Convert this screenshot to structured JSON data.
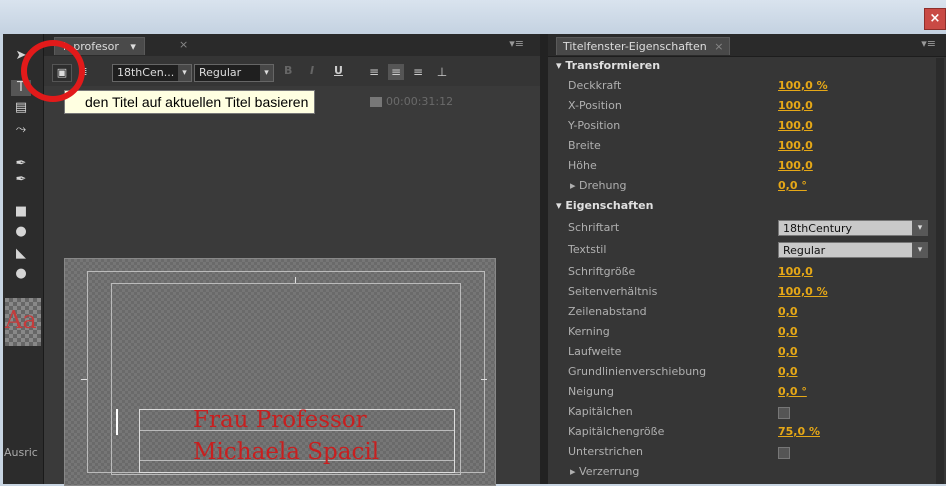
{
  "window": {
    "close_glyph": "×"
  },
  "tools": {
    "icons": [
      "selection-arrow-icon",
      "type-tool-icon",
      "area-type-icon",
      "path-type-icon",
      "pen-tool-icon",
      "add-anchor-icon",
      "rectangle-tool-icon",
      "ellipse-tool-icon",
      "wedge-tool-icon",
      "ellipse-small-icon"
    ],
    "swatch_text": "Aa",
    "bottom_label": "Ausric"
  },
  "title_panel": {
    "tab_label": "l: profesor",
    "tab_dropdown": "▾",
    "tab_close": "×",
    "menu_glyph": "▾≡",
    "toolbar": {
      "font_name": "18thCen...",
      "font_style": "Regular",
      "bold": "B",
      "italic": "I",
      "underline": "U"
    },
    "tooltip": "den Titel auf aktuellen Titel basieren",
    "timecode": "00:00:31:12",
    "text_lines": [
      "Frau Professor",
      "Michaela Spacil"
    ]
  },
  "properties": {
    "tab_label": "Titelfenster-Eigenschaften",
    "tab_close": "×",
    "menu_glyph": "▾≡",
    "sections": {
      "transform": "Transformieren",
      "properties": "Eigenschaften"
    },
    "rows": {
      "deckkraft": {
        "label": "Deckkraft",
        "value": "100,0 %"
      },
      "xpos": {
        "label": "X-Position",
        "value": "100,0"
      },
      "ypos": {
        "label": "Y-Position",
        "value": "100,0"
      },
      "breite": {
        "label": "Breite",
        "value": "100,0"
      },
      "hoehe": {
        "label": "Höhe",
        "value": "100,0"
      },
      "drehung": {
        "label": "Drehung",
        "value": "0,0 °"
      },
      "schriftart": {
        "label": "Schriftart",
        "value": "18thCentury"
      },
      "textstil": {
        "label": "Textstil",
        "value": "Regular"
      },
      "schriftgroesse": {
        "label": "Schriftgröße",
        "value": "100,0"
      },
      "seitenverhaeltnis": {
        "label": "Seitenverhältnis",
        "value": "100,0 %"
      },
      "zeilenabstand": {
        "label": "Zeilenabstand",
        "value": "0,0"
      },
      "kerning": {
        "label": "Kerning",
        "value": "0,0"
      },
      "laufweite": {
        "label": "Laufweite",
        "value": "0,0"
      },
      "grundlinie": {
        "label": "Grundlinienverschiebung",
        "value": "0,0"
      },
      "neigung": {
        "label": "Neigung",
        "value": "0,0 °"
      },
      "kapitaelchen": {
        "label": "Kapitälchen"
      },
      "kapitaelchengroesse": {
        "label": "Kapitälchengröße",
        "value": "75,0 %"
      },
      "unterstrichen": {
        "label": "Unterstrichen"
      },
      "verzerrung": {
        "label": "Verzerrung"
      }
    }
  },
  "colors": {
    "accent_value": "#e6a817",
    "highlight_circle": "#e21a1a",
    "title_text": "#c81f1f"
  }
}
